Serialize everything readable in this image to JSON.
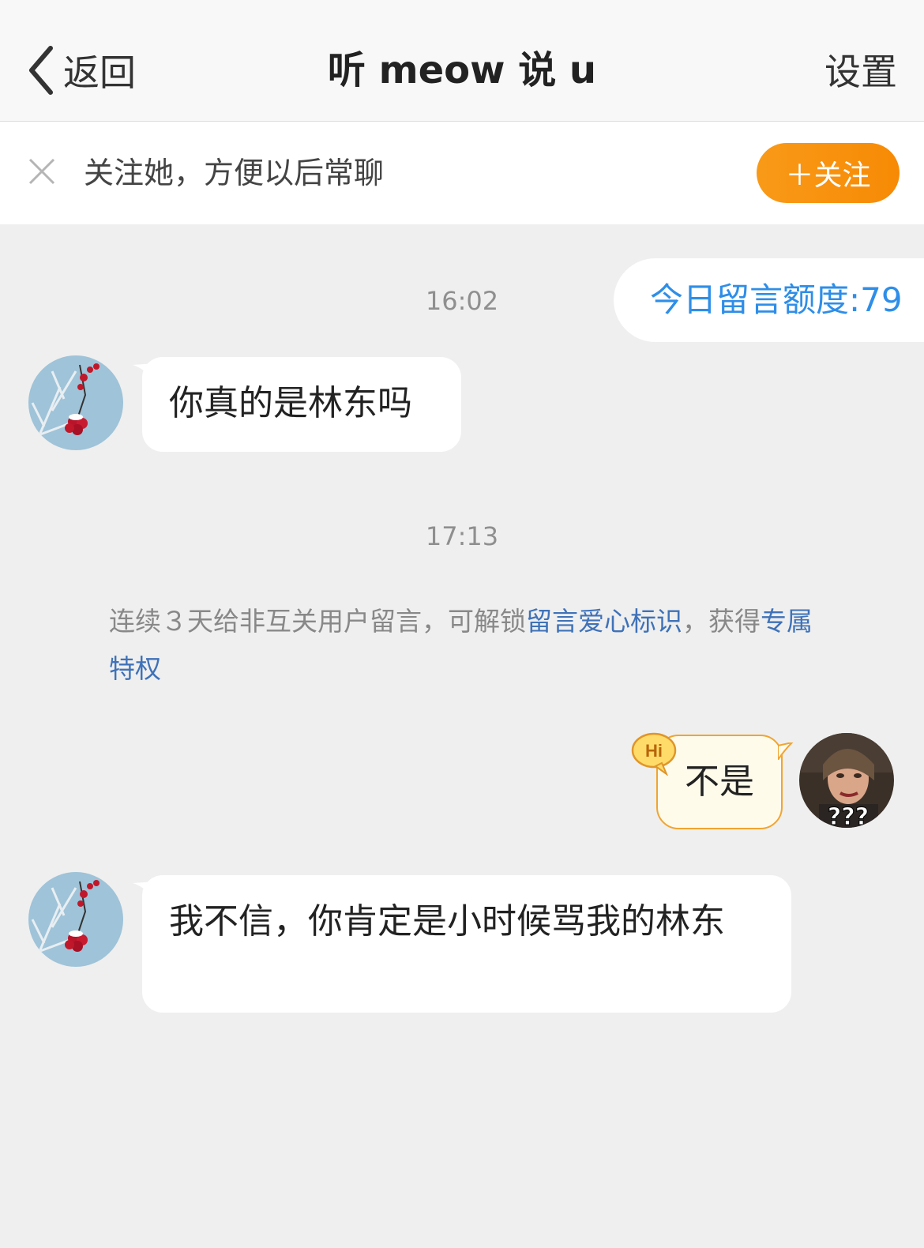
{
  "header": {
    "back_label": "返回",
    "title": "听 meow 说 u",
    "settings_label": "设置"
  },
  "follow_bar": {
    "prompt": "关注她，方便以后常聊",
    "follow_label": "＋关注"
  },
  "quota": {
    "text": "今日留言额度:79"
  },
  "messages": [
    {
      "time": "16:02",
      "sender": "other",
      "text": "你真的是林东吗"
    },
    {
      "time": "17:13"
    },
    {
      "sender": "me",
      "text": "不是",
      "badge": "Hi"
    },
    {
      "sender": "other",
      "text": "我不信，你肯定是小时候骂我的林东"
    }
  ],
  "system_note": {
    "part1": "连续３天给非互关用户留言，可解锁",
    "link1": "留言爱心标识",
    "part2": "，获得",
    "link2": "专属特权"
  },
  "my_avatar_caption": "???",
  "colors": {
    "accent_orange": "#f78a05",
    "link_blue": "#3f72b8",
    "quota_blue": "#2e8ee8"
  }
}
